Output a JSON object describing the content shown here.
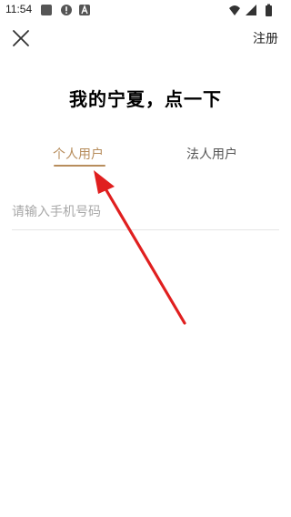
{
  "status_bar": {
    "time": "11:54",
    "icons_left": [
      "gallery-icon",
      "alert-icon",
      "app-a-icon"
    ],
    "icons_right": [
      "wifi-icon",
      "signal-icon",
      "battery-icon"
    ]
  },
  "header": {
    "close_icon": "close-icon",
    "register_label": "注册"
  },
  "title": "我的宁夏，点一下",
  "tabs": {
    "personal": "个人用户",
    "legal": "法人用户",
    "active": "personal"
  },
  "phone_input": {
    "value": "",
    "placeholder": "请输入手机号码"
  },
  "colors": {
    "accent": "#b78d5c",
    "annotation_arrow": "#e01f1f"
  }
}
